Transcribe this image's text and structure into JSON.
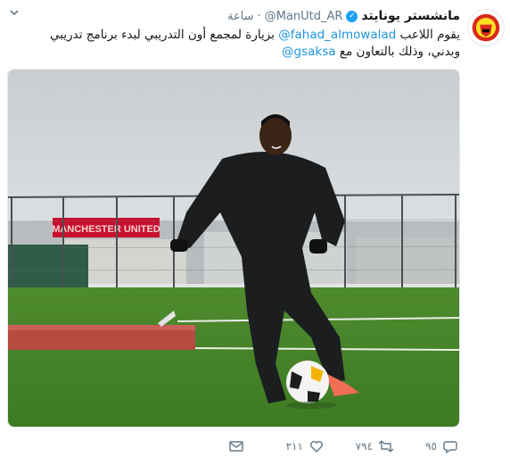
{
  "account": {
    "display_name": "مانشستر يونايتد",
    "handle": "@ManUtd_AR",
    "timestamp": "ساعة"
  },
  "tweet": {
    "text_before": "يقوم اللاعب ",
    "mention1": "@fahad_almowalad",
    "text_middle": " بزيارة لمجمع أون التدريبي لبدء برنامج تدريبي وبدني، وذلك بالتعاون مع ",
    "mention2": "@gsaksa"
  },
  "media": {
    "stadium_sign": "MANCHESTER UNITED"
  },
  "stats": {
    "replies": "٩٥",
    "retweets": "٧٩٤",
    "likes": "٢١١"
  },
  "icons": {
    "caret": "chevron-down-icon",
    "verified": "verified-badge-icon",
    "reply": "reply-icon",
    "retweet": "retweet-icon",
    "like": "heart-icon",
    "dm": "envelope-icon"
  },
  "colors": {
    "link": "#1b95e0",
    "verified": "#1da1f2",
    "muted": "#657786"
  }
}
